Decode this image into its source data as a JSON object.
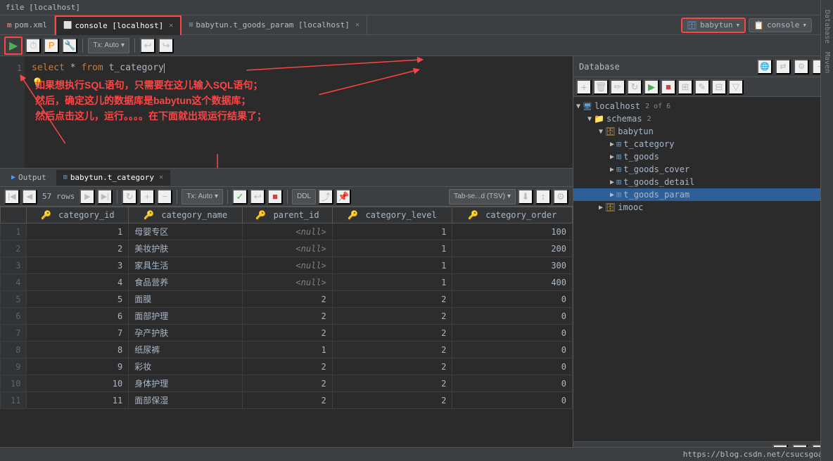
{
  "titleBar": {
    "text": "file [localhost]"
  },
  "tabs": [
    {
      "id": "pom",
      "label": "pom.xml",
      "icon": "m",
      "active": false,
      "closeable": false
    },
    {
      "id": "console",
      "label": "console [localhost]",
      "icon": "c",
      "active": true,
      "closeable": true
    },
    {
      "id": "goods_param",
      "label": "babytun.t_goods_param [localhost]",
      "icon": "t",
      "active": false,
      "closeable": true
    }
  ],
  "toolbar": {
    "run_label": "▶",
    "tx_label": "Tx: Auto",
    "dropdown_arrow": "▾"
  },
  "editor": {
    "line1": "select * from t_category",
    "lineNumbers": [
      "1"
    ]
  },
  "annotation": {
    "line1": "如果想执行SQL语句，只需要在这儿输入SQL语句；",
    "line2": "然后，确定这儿的数据库是babytun这个数据库；",
    "line3": "然后点击这儿，运行。。。。在下面就出现运行结果了；"
  },
  "connectionSelector": {
    "db_name": "babytun",
    "console_label": "console",
    "highlighted": true
  },
  "database": {
    "title": "Database",
    "tree": {
      "localhost": {
        "label": "localhost",
        "badge": "2 of 6",
        "expanded": true,
        "children": {
          "schemas": {
            "label": "schemas",
            "badge": "2",
            "expanded": true,
            "children": {
              "babytun": {
                "label": "babytun",
                "expanded": true,
                "tables": [
                  {
                    "name": "t_category",
                    "selected": false
                  },
                  {
                    "name": "t_goods",
                    "selected": false
                  },
                  {
                    "name": "t_goods_cover",
                    "selected": false
                  },
                  {
                    "name": "t_goods_detail",
                    "selected": false
                  },
                  {
                    "name": "t_goods_param",
                    "selected": true
                  }
                ]
              },
              "imooc": {
                "label": "imooc",
                "expanded": false
              }
            }
          }
        }
      }
    }
  },
  "results": {
    "tabs": [
      {
        "label": "Output",
        "active": false
      },
      {
        "label": "babytun.t_category",
        "active": true,
        "closeable": true
      }
    ],
    "rowCount": "57 rows",
    "txLabel": "Tx: Auto",
    "tabSaveLabel": "Tab-se...d (TSV)",
    "columns": [
      {
        "name": "category_id",
        "icon": "🔑"
      },
      {
        "name": "category_name",
        "icon": "🔑"
      },
      {
        "name": "parent_id",
        "icon": "🔑"
      },
      {
        "name": "category_level",
        "icon": "🔑"
      },
      {
        "name": "category_order",
        "icon": "🔑"
      }
    ],
    "rows": [
      {
        "num": 1,
        "category_id": 1,
        "category_name": "母婴专区",
        "parent_id": null,
        "category_level": 1,
        "category_order": 100
      },
      {
        "num": 2,
        "category_id": 2,
        "category_name": "美妆护肤",
        "parent_id": null,
        "category_level": 1,
        "category_order": 200
      },
      {
        "num": 3,
        "category_id": 3,
        "category_name": "家具生活",
        "parent_id": null,
        "category_level": 1,
        "category_order": 300
      },
      {
        "num": 4,
        "category_id": 4,
        "category_name": "食品营养",
        "parent_id": null,
        "category_level": 1,
        "category_order": 400
      },
      {
        "num": 5,
        "category_id": 5,
        "category_name": "面膜",
        "parent_id": 2,
        "category_level": 2,
        "category_order": 0
      },
      {
        "num": 6,
        "category_id": 6,
        "category_name": "面部护理",
        "parent_id": 2,
        "category_level": 2,
        "category_order": 0
      },
      {
        "num": 7,
        "category_id": 7,
        "category_name": "孕产护肤",
        "parent_id": 2,
        "category_level": 2,
        "category_order": 0
      },
      {
        "num": 8,
        "category_id": 8,
        "category_name": "纸尿裤",
        "parent_id": 1,
        "category_level": 2,
        "category_order": 0
      },
      {
        "num": 9,
        "category_id": 9,
        "category_name": "彩妆",
        "parent_id": 2,
        "category_level": 2,
        "category_order": 0
      },
      {
        "num": 10,
        "category_id": 10,
        "category_name": "身体护理",
        "parent_id": 2,
        "category_level": 2,
        "category_order": 0
      },
      {
        "num": 11,
        "category_id": 11,
        "category_name": "面部保湿",
        "parent_id": 2,
        "category_level": 2,
        "category_order": 0
      }
    ]
  },
  "statusBar": {
    "left": "",
    "right": "https://blog.csdn.net/csucsgoat"
  },
  "colors": {
    "accent": "#4a9eff",
    "red_annotation": "#ff4444",
    "run_green": "#4caf50",
    "keyword_orange": "#cc7832",
    "table_blue": "#6897bb"
  }
}
